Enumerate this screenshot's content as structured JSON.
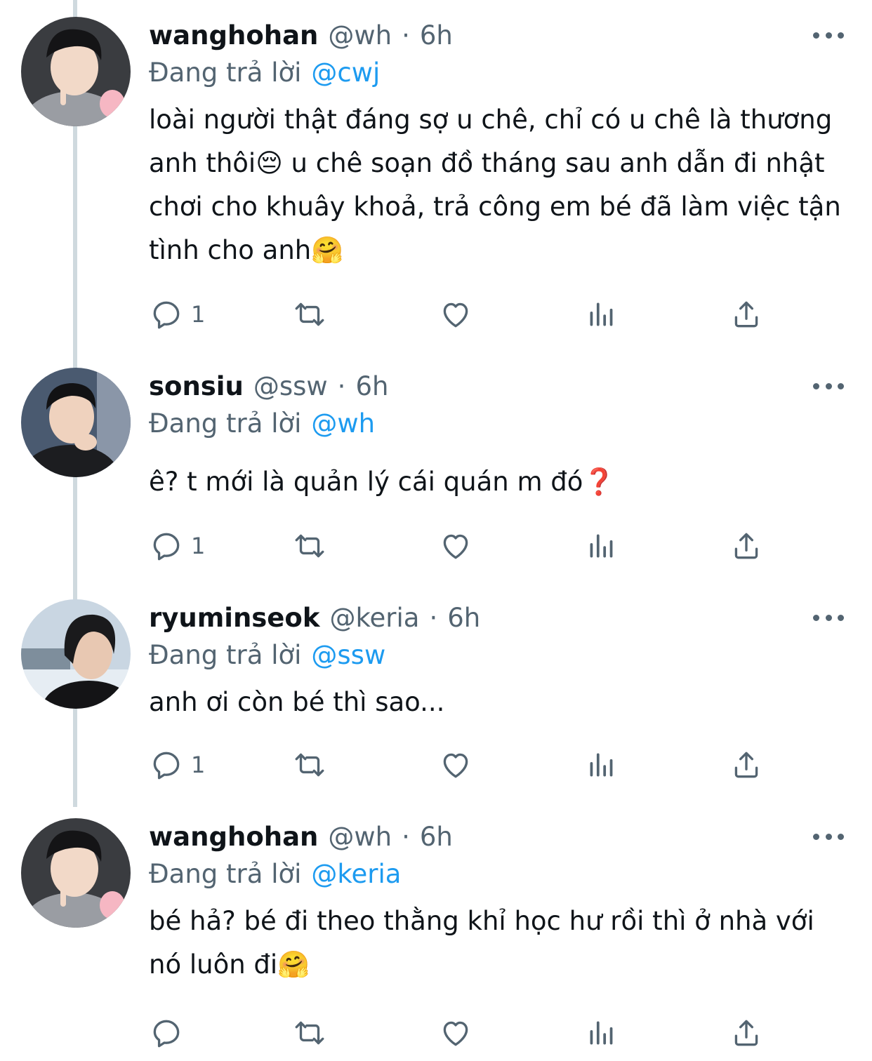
{
  "tweets": [
    {
      "name": "wanghohan",
      "handle": "@wh",
      "dot": "·",
      "time": "6h",
      "replying_label": "Đang trả lời",
      "replying_to": "@cwj",
      "text": "loài người thật đáng sợ u chê, chỉ có u chê là thương anh thôi😔 u chê soạn đồ tháng sau anh dẫn đi nhật chơi cho khuây khoả, trả công em bé đã làm việc tận tình cho anh🤗",
      "reply_count": "1"
    },
    {
      "name": "sonsiu",
      "handle": "@ssw",
      "dot": "·",
      "time": "6h",
      "replying_label": "Đang trả lời",
      "replying_to": "@wh",
      "text": "ê? t mới là quản lý cái quán m đó❓",
      "reply_count": "1"
    },
    {
      "name": "ryuminseok",
      "handle": "@keria",
      "dot": "·",
      "time": "6h",
      "replying_label": "Đang trả lời",
      "replying_to": "@ssw",
      "text": "anh ơi còn bé thì sao...",
      "reply_count": "1"
    },
    {
      "name": "wanghohan",
      "handle": "@wh",
      "dot": "·",
      "time": "6h",
      "replying_label": "Đang trả lời",
      "replying_to": "@keria",
      "text": "bé hả? bé đi theo thằng khỉ học hư rồi thì ở nhà với nó luôn đi🤗",
      "reply_count": ""
    }
  ],
  "icons": {
    "reply": "reply-icon",
    "retweet": "retweet-icon",
    "like": "heart-icon",
    "views": "views-icon",
    "share": "share-icon",
    "more": "more-icon"
  },
  "colors": {
    "text": "#0f1419",
    "secondary": "#536471",
    "link": "#1d9bf0",
    "thread_line": "#cfd9de"
  }
}
